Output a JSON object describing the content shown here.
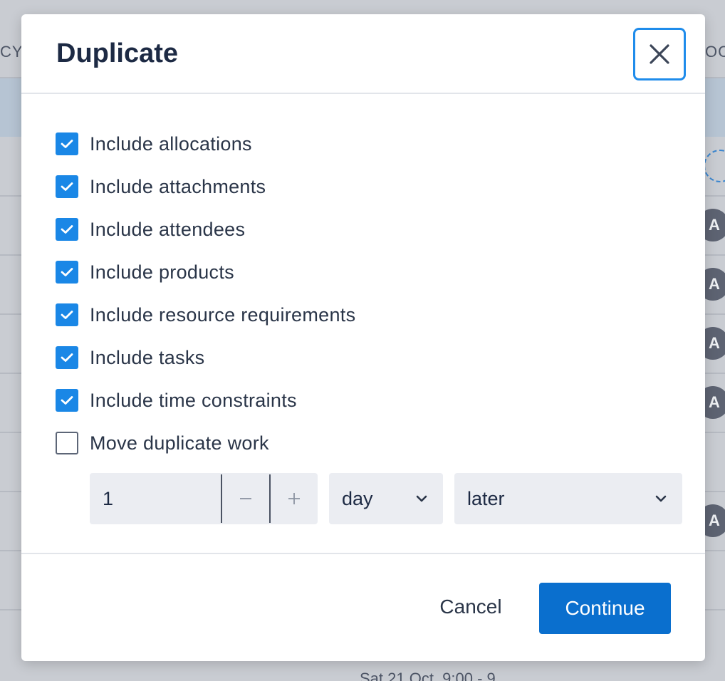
{
  "background": {
    "header_left_fragment": "CY",
    "header_right_fragment": "OCA",
    "avatar_letter": "A",
    "bottom_text": "Sat 21 Oct, 9:00 - 9"
  },
  "dialog": {
    "title": "Duplicate",
    "close_icon": "close-icon",
    "options": [
      {
        "label": "Include allocations",
        "checked": true
      },
      {
        "label": "Include attachments",
        "checked": true
      },
      {
        "label": "Include attendees",
        "checked": true
      },
      {
        "label": "Include products",
        "checked": true
      },
      {
        "label": "Include resource requirements",
        "checked": true
      },
      {
        "label": "Include tasks",
        "checked": true
      },
      {
        "label": "Include time constraints",
        "checked": true
      },
      {
        "label": "Move duplicate work",
        "checked": false
      }
    ],
    "offset": {
      "amount": "1",
      "decrement_symbol": "−",
      "increment_symbol": "+",
      "unit": "day",
      "direction": "later"
    },
    "footer": {
      "cancel_label": "Cancel",
      "continue_label": "Continue"
    }
  },
  "colors": {
    "accent": "#1a87e6",
    "primary_button": "#0a6fce",
    "focus_ring": "#1f8ceb"
  }
}
